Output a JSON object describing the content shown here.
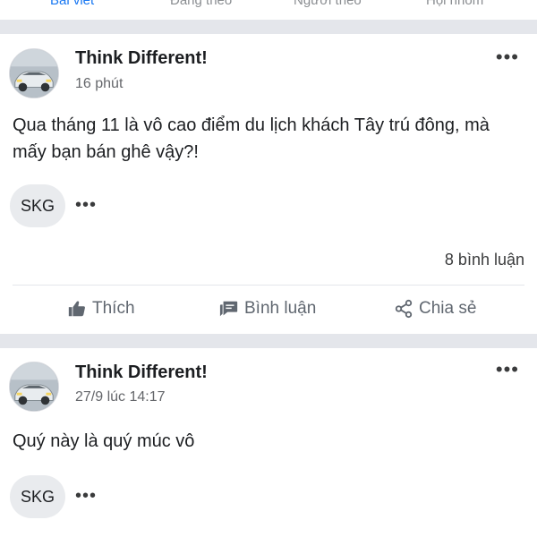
{
  "tabs": [
    {
      "label": "Bài viết",
      "active": true
    },
    {
      "label": "Đang theo",
      "active": false
    },
    {
      "label": "Người theo",
      "active": false
    },
    {
      "label": "Hội nhóm",
      "active": false
    }
  ],
  "posts": [
    {
      "author": "Think Different!",
      "time": "16 phút",
      "content": "Qua tháng 11 là vô cao điểm du lịch khách Tây trú đông, mà mấy bạn bán ghê vậy?!",
      "tag": "SKG",
      "more_glyph": "•••",
      "comment_count": "8 bình luận",
      "actions": {
        "like": "Thích",
        "comment": "Bình luận",
        "share": "Chia sẻ"
      }
    },
    {
      "author": "Think Different!",
      "time": "27/9 lúc 14:17",
      "content": "Quý này là quý múc vô",
      "tag": "SKG",
      "more_glyph": "•••"
    }
  ],
  "icons": {
    "like": "thumbs-up-icon",
    "comment": "comment-icon",
    "share": "share-icon",
    "more": "more-horizontal-icon"
  },
  "colors": {
    "separator": "#e4e6eb",
    "chip_bg": "#e9ebee",
    "muted_text": "#65676b",
    "accent": "#1877f2"
  }
}
